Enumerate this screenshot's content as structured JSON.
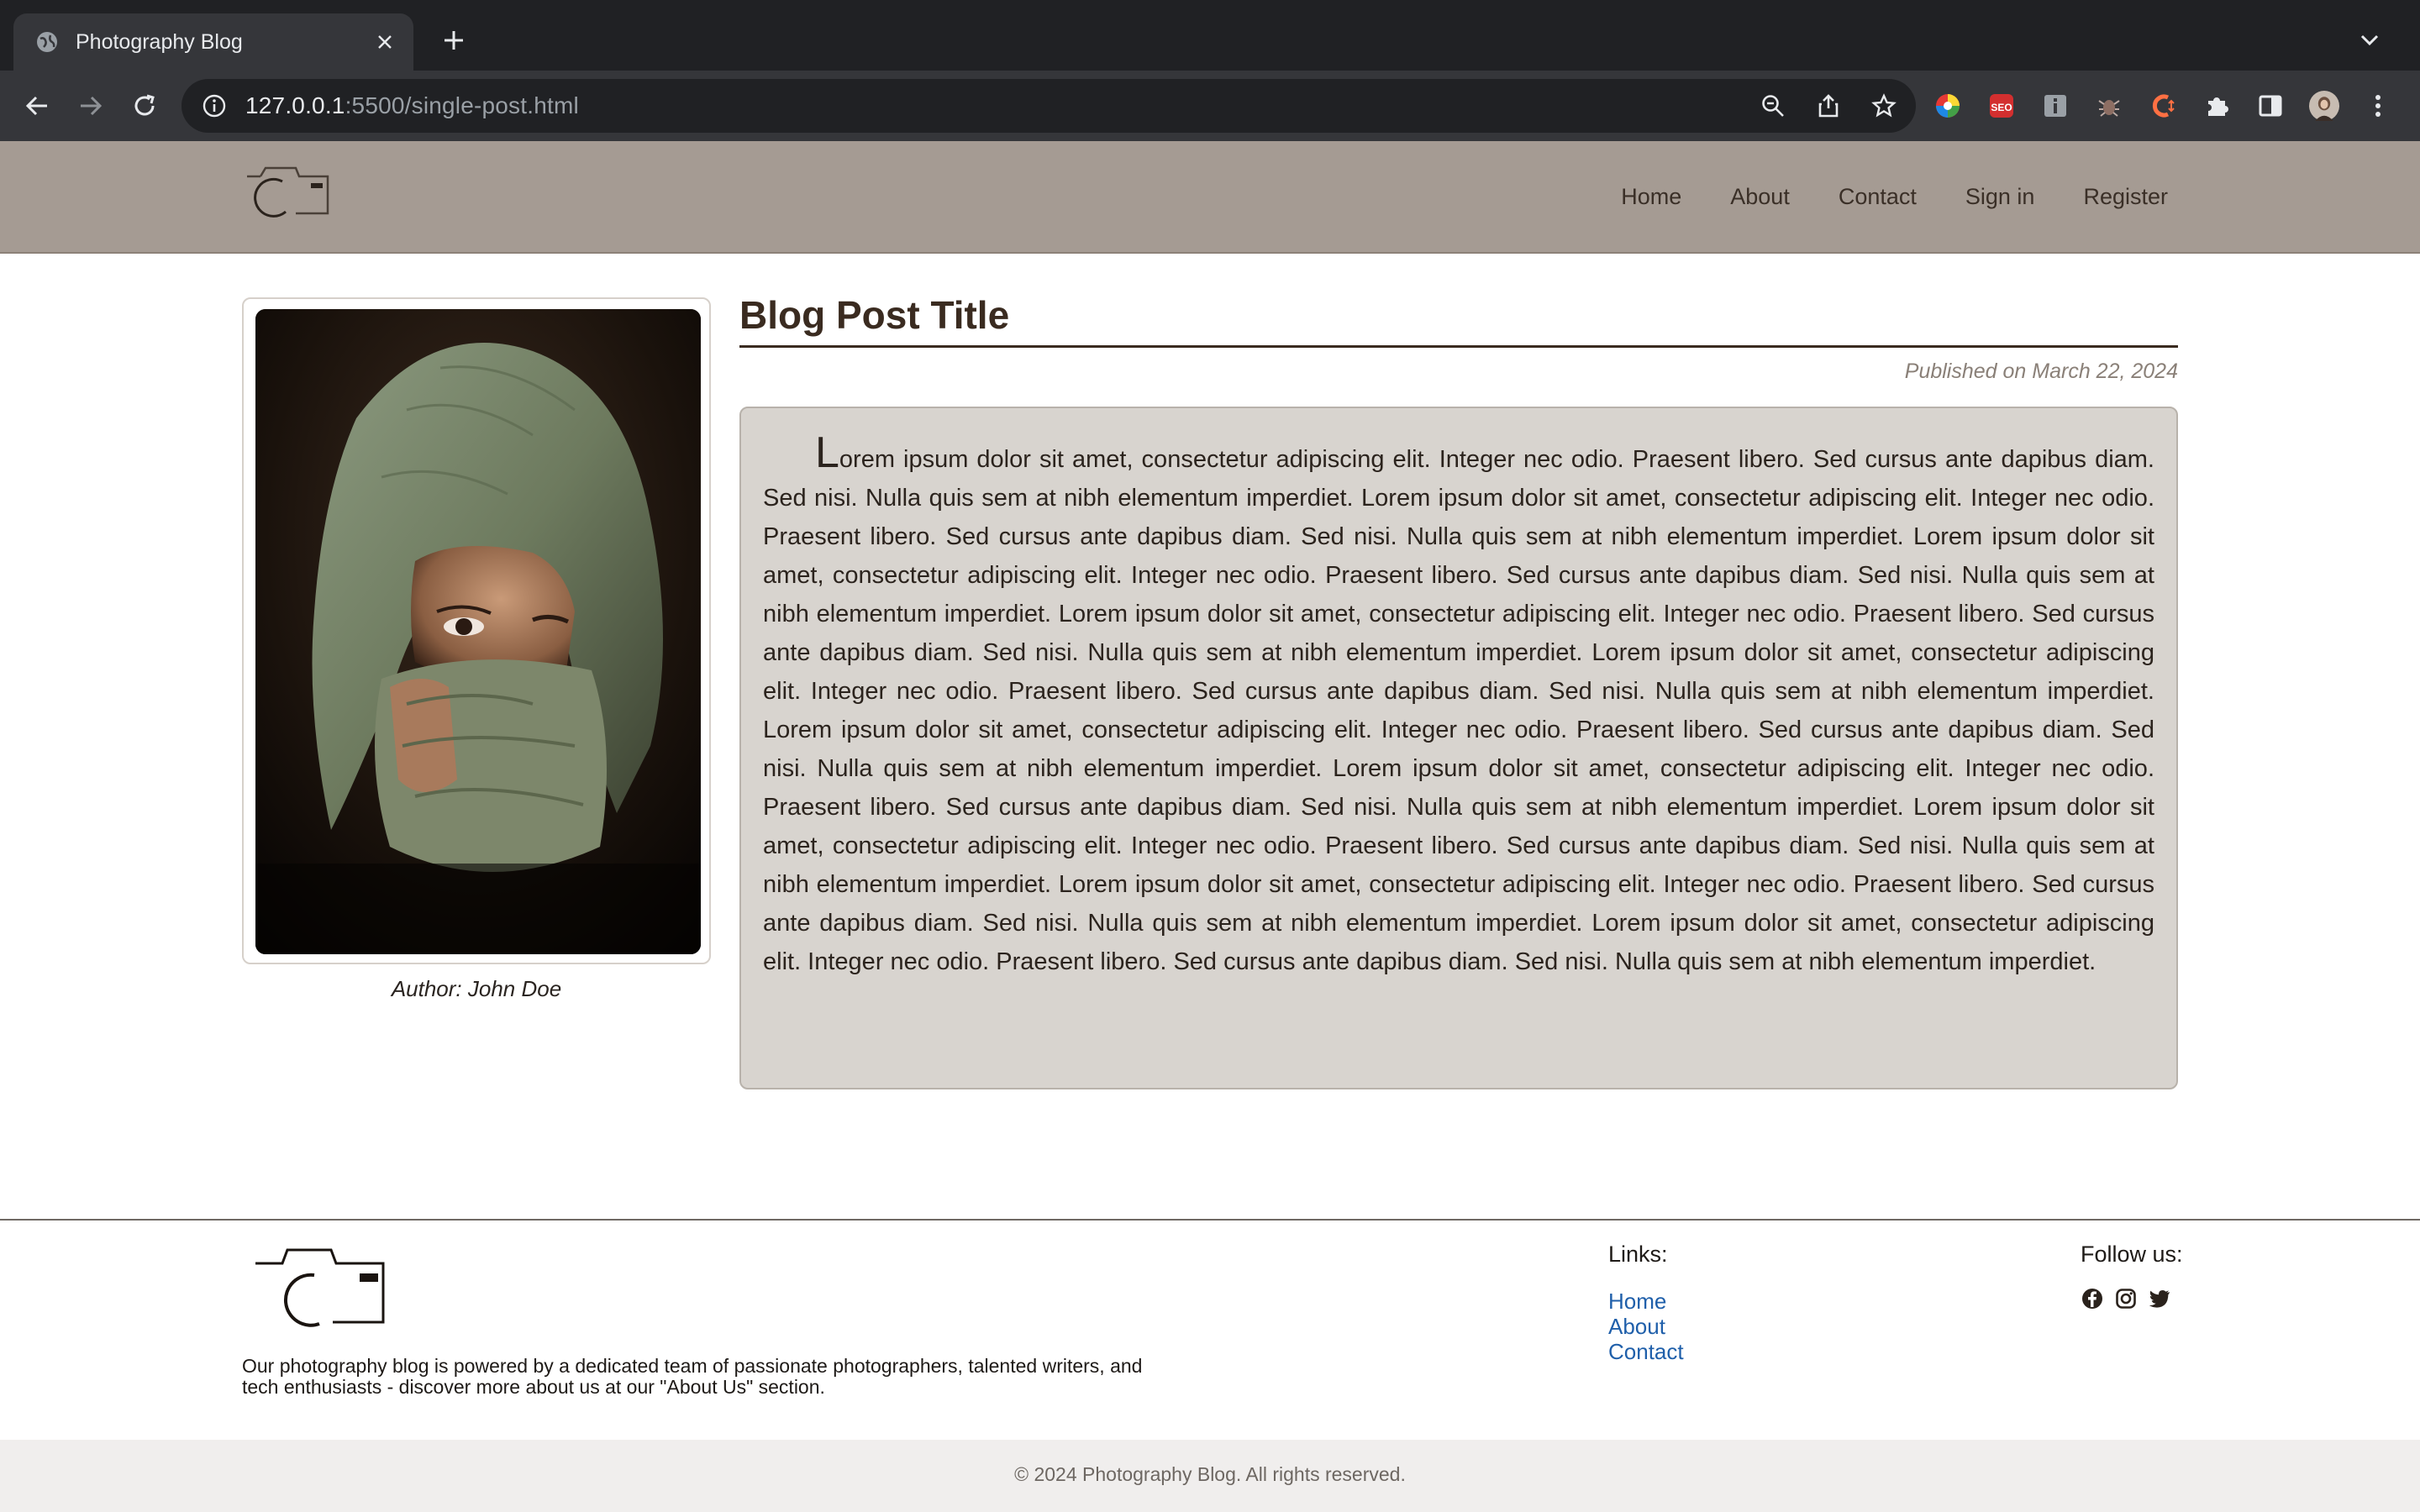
{
  "browser": {
    "tab_title": "Photography Blog",
    "url_host": "127.0.0.1",
    "url_rest": ":5500/single-post.html"
  },
  "header": {
    "logo_icon": "camera-logo-icon",
    "nav": [
      "Home",
      "About",
      "Contact",
      "Sign in",
      "Register"
    ]
  },
  "post": {
    "title": "Blog Post Title",
    "published": "Published on March 22, 2024",
    "body": "Lorem ipsum dolor sit amet, consectetur adipiscing elit. Integer nec odio. Praesent libero. Sed cursus ante dapibus diam. Sed nisi. Nulla quis sem at nibh elementum imperdiet. Lorem ipsum dolor sit amet, consectetur adipiscing elit. Integer nec odio. Praesent libero. Sed cursus ante dapibus diam. Sed nisi. Nulla quis sem at nibh elementum imperdiet. Lorem ipsum dolor sit amet, consectetur adipiscing elit. Integer nec odio. Praesent libero. Sed cursus ante dapibus diam. Sed nisi. Nulla quis sem at nibh elementum imperdiet. Lorem ipsum dolor sit amet, consectetur adipiscing elit. Integer nec odio. Praesent libero. Sed cursus ante dapibus diam. Sed nisi. Nulla quis sem at nibh elementum imperdiet. Lorem ipsum dolor sit amet, consectetur adipiscing elit. Integer nec odio. Praesent libero. Sed cursus ante dapibus diam. Sed nisi. Nulla quis sem at nibh elementum imperdiet. Lorem ipsum dolor sit amet, consectetur adipiscing elit. Integer nec odio. Praesent libero. Sed cursus ante dapibus diam. Sed nisi. Nulla quis sem at nibh elementum imperdiet. Lorem ipsum dolor sit amet, consectetur adipiscing elit. Integer nec odio. Praesent libero. Sed cursus ante dapibus diam. Sed nisi. Nulla quis sem at nibh elementum imperdiet. Lorem ipsum dolor sit amet, consectetur adipiscing elit. Integer nec odio. Praesent libero. Sed cursus ante dapibus diam. Sed nisi. Nulla quis sem at nibh elementum imperdiet. Lorem ipsum dolor sit amet, consectetur adipiscing elit. Integer nec odio. Praesent libero. Sed cursus ante dapibus diam. Sed nisi. Nulla quis sem at nibh elementum imperdiet. Lorem ipsum dolor sit amet, consectetur adipiscing elit. Integer nec odio. Praesent libero. Sed cursus ante dapibus diam. Sed nisi. Nulla quis sem at nibh elementum imperdiet.",
    "author": "Author: John Doe",
    "photo_icon": "portrait-photo"
  },
  "footer": {
    "about": "Our photography blog is powered by a dedicated team of passionate photographers, talented writers, and tech enthusiasts - discover more about us at our \"About Us\" section.",
    "links_title": "Links:",
    "links": [
      "Home",
      "About",
      "Contact"
    ],
    "follow_title": "Follow us:",
    "social_icons": [
      "facebook-icon",
      "instagram-icon",
      "twitter-icon"
    ],
    "copyright": "© 2024 Photography Blog. All rights reserved."
  },
  "colors": {
    "header_bg": "#a59b93",
    "post_body_bg": "#d8d4cf",
    "title_color": "#3a2b20",
    "link_color": "#1f5faa"
  }
}
